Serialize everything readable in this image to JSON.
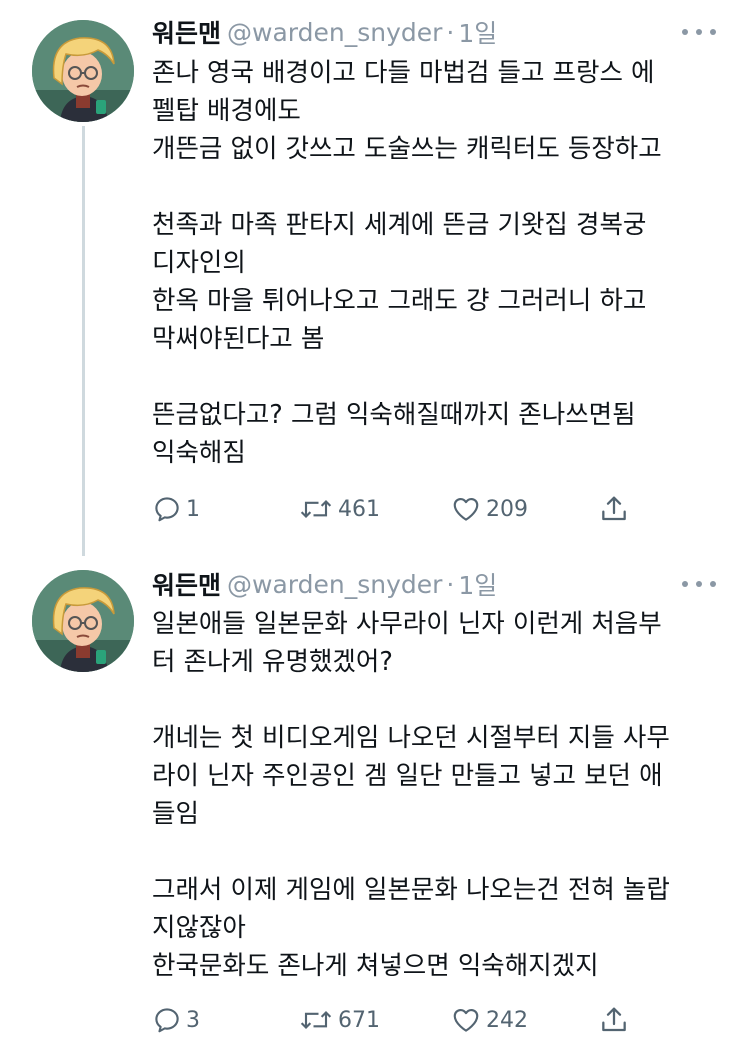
{
  "tweets": [
    {
      "author": {
        "name": "워든맨",
        "handle": "@warden_snyder",
        "time": "1일"
      },
      "lines": [
        "존나 영국 배경이고 다들 마법검 들고 프랑스 에",
        "펠탑 배경에도",
        "개뜬금 없이 갓쓰고 도술쓰는 캐릭터도 등장하고",
        "",
        "천족과 마족  판타지 세계에 뜬금 기왓집 경복궁",
        "디자인의",
        "한옥 마을 튀어나오고 그래도 걍 그러러니 하고",
        "막써야된다고 봄",
        "",
        "뜬금없다고? 그럼 익숙해질때까지 존나쓰면됨",
        "익숙해짐"
      ],
      "stats": {
        "replies": "1",
        "retweets": "461",
        "likes": "209"
      },
      "icons": {
        "reply": "reply-icon",
        "retweet": "retweet-icon",
        "like": "heart-icon",
        "share": "share-icon",
        "more": "more-icon"
      }
    },
    {
      "author": {
        "name": "워든맨",
        "handle": "@warden_snyder",
        "time": "1일"
      },
      "lines": [
        "일본애들 일본문화 사무라이 닌자 이런게 처음부",
        "터 존나게 유명했겠어?",
        "",
        "개네는 첫 비디오게임 나오던 시절부터 지들 사무",
        "라이 닌자 주인공인 겜 일단 만들고 넣고 보던 애",
        "들임",
        "",
        "그래서 이제 게임에 일본문화 나오는건 전혀 놀랍",
        "지않잖아",
        "한국문화도 존나게 쳐넣으면 익숙해지겠지"
      ],
      "stats": {
        "replies": "3",
        "retweets": "671",
        "likes": "242"
      },
      "icons": {
        "reply": "reply-icon",
        "retweet": "retweet-icon",
        "like": "heart-icon",
        "share": "share-icon",
        "more": "more-icon"
      }
    }
  ],
  "colors": {
    "text": "#0f1419",
    "secondary": "#536471",
    "muted": "#8b98a5",
    "thread_line": "#cfd9de",
    "avatar_bg": "#5a8a77",
    "hair": "#f4d37a"
  }
}
